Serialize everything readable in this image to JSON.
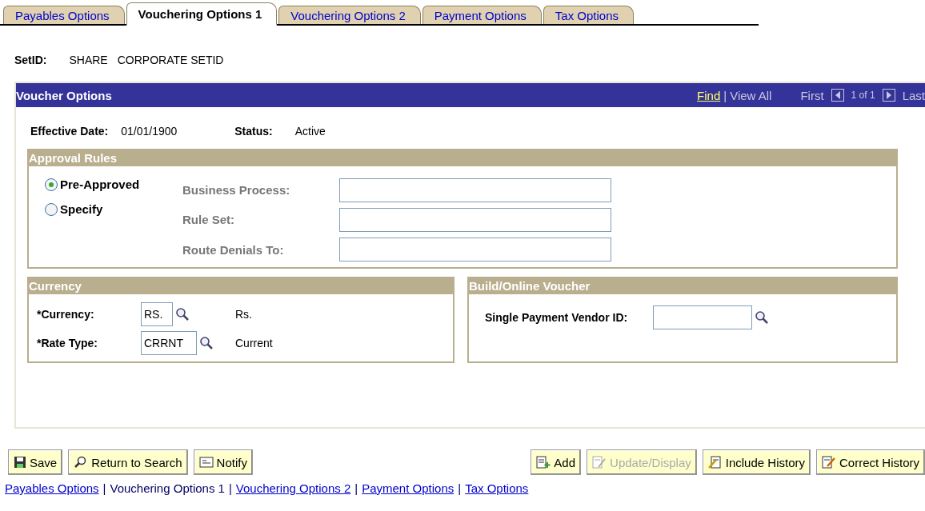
{
  "tabs": [
    {
      "label": "Payables Options",
      "selected": false
    },
    {
      "label": "Vouchering Options 1",
      "selected": true
    },
    {
      "label": "Vouchering Options 2",
      "selected": false
    },
    {
      "label": "Payment Options",
      "selected": false
    },
    {
      "label": "Tax Options",
      "selected": false
    }
  ],
  "setid": {
    "label": "SetID:",
    "value": "SHARE",
    "description": "CORPORATE SETID"
  },
  "voucher_options": {
    "title": "Voucher Options",
    "find": "Find",
    "separator": "|",
    "view_all": "View All",
    "first": "First",
    "count": "1 of 1",
    "last": "Last",
    "effective_date": {
      "label": "Effective Date:",
      "value": "01/01/1900"
    },
    "status": {
      "label": "Status:",
      "value": "Active"
    },
    "approval_rules": {
      "title": "Approval Rules",
      "options": [
        {
          "label": "Pre-Approved",
          "selected": true
        },
        {
          "label": "Specify",
          "selected": false
        }
      ],
      "fields": [
        {
          "label": "Business Process:"
        },
        {
          "label": "Rule Set:"
        },
        {
          "label": "Route Denials To:"
        }
      ]
    },
    "currency": {
      "title": "Currency",
      "fields": [
        {
          "label": "*Currency:",
          "value": "RS.",
          "description": "Rs."
        },
        {
          "label": "*Rate Type:",
          "value": "CRRNT",
          "description": "Current"
        }
      ]
    },
    "build_online_voucher": {
      "title": "Build/Online Voucher",
      "field": {
        "label": "Single Payment Vendor ID:"
      }
    }
  },
  "buttons_left": [
    {
      "label": "Save",
      "kind": "save",
      "disabled": false
    },
    {
      "label": "Return to Search",
      "kind": "search",
      "disabled": false
    },
    {
      "label": "Notify",
      "kind": "notify",
      "disabled": false
    }
  ],
  "buttons_right": [
    {
      "label": "Add",
      "kind": "add",
      "disabled": false
    },
    {
      "label": "Update/Display",
      "kind": "update",
      "disabled": true
    },
    {
      "label": "Include History",
      "kind": "history",
      "disabled": false
    },
    {
      "label": "Correct History",
      "kind": "correct",
      "disabled": false
    }
  ],
  "footer_separator": "|",
  "footer_links": [
    {
      "label": "Payables Options",
      "selected": false
    },
    {
      "label": "Vouchering Options 1",
      "selected": true
    },
    {
      "label": "Vouchering Options 2",
      "selected": false
    },
    {
      "label": "Payment Options",
      "selected": false
    },
    {
      "label": "Tax Options",
      "selected": false
    }
  ]
}
